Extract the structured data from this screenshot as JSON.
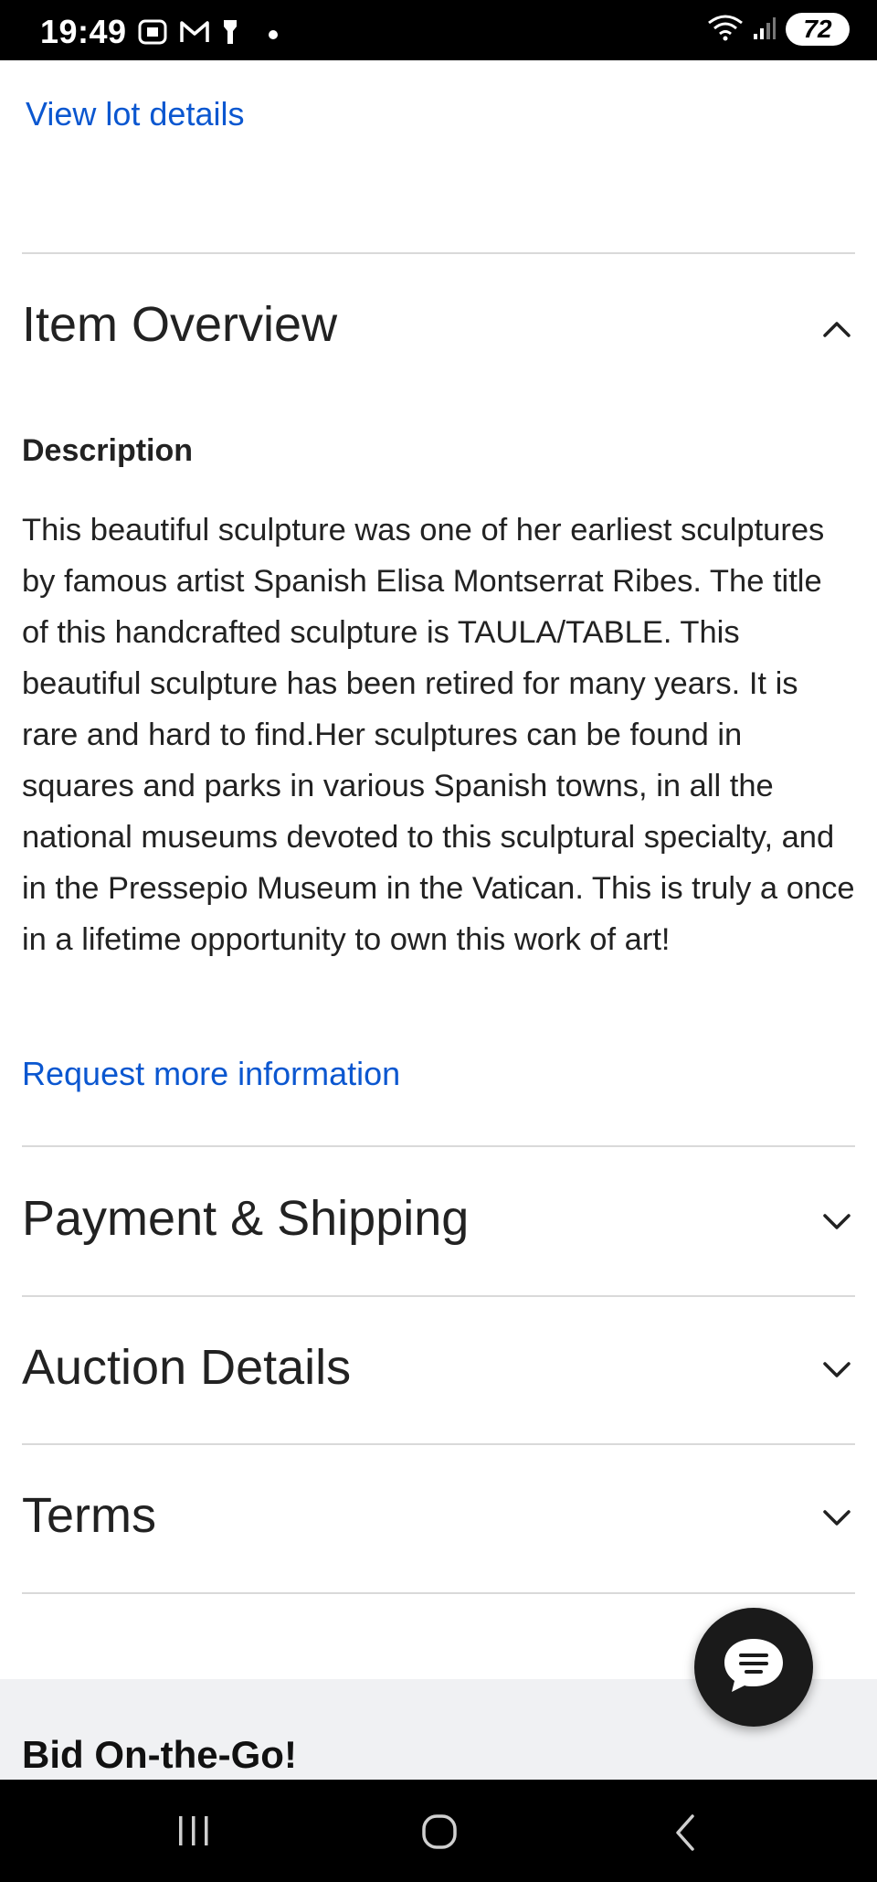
{
  "status_bar": {
    "time": "19:49",
    "battery": "72",
    "left_icons": [
      "screenshot-icon",
      "gmail-icon",
      "flashlight-icon",
      "dot-icon"
    ],
    "right_icons": [
      "wifi-icon",
      "signal-icon",
      "battery-icon"
    ]
  },
  "links": {
    "view_lot": "View lot details",
    "request_info": "Request more information"
  },
  "item_overview": {
    "title": "Item Overview",
    "description_label": "Description",
    "description_text": "This beautiful sculpture was one of her earliest sculptures by famous artist Spanish Elisa Montserrat Ribes. The title of this handcrafted sculpture is TAULA/TABLE. This beautiful sculpture has been retired for many years. It is rare and hard to find.Her sculptures can be found in squares and parks in various Spanish towns, in all the national museums devoted to this sculptural specialty, and in the Pressepio Museum in the Vatican. This is truly a once in a lifetime opportunity to own this work of art!",
    "expanded": true
  },
  "sections": [
    {
      "title": "Payment & Shipping",
      "expanded": false
    },
    {
      "title": "Auction Details",
      "expanded": false
    },
    {
      "title": "Terms",
      "expanded": false
    }
  ],
  "promo": {
    "title": "Bid On-the-Go!"
  },
  "chat": {
    "icon": "chat-icon"
  },
  "nav": {
    "icons": [
      "recent-apps-icon",
      "home-icon",
      "back-icon"
    ]
  },
  "colors": {
    "link": "#0b57d0",
    "text": "#222222",
    "divider": "#d9d9d9",
    "band": "#f0f1f3"
  }
}
